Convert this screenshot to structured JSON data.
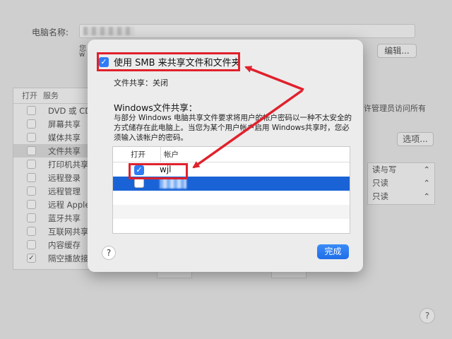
{
  "background": {
    "computer_name_label": "电脑名称:",
    "subtext_line1": "您",
    "subtext_line2": "w",
    "edit_button": "编辑...",
    "services_header": {
      "on": "打开",
      "service": "服务"
    },
    "services": [
      {
        "label": "DVD 或 CD",
        "checked": false,
        "selected": false
      },
      {
        "label": "屏幕共享",
        "checked": false,
        "selected": false
      },
      {
        "label": "媒体共享",
        "checked": false,
        "selected": false
      },
      {
        "label": "文件共享",
        "checked": false,
        "selected": true
      },
      {
        "label": "打印机共享",
        "checked": false,
        "selected": false
      },
      {
        "label": "远程登录",
        "checked": false,
        "selected": false
      },
      {
        "label": "远程管理",
        "checked": false,
        "selected": false
      },
      {
        "label": "远程 Apple",
        "checked": false,
        "selected": false
      },
      {
        "label": "蓝牙共享",
        "checked": false,
        "selected": false
      },
      {
        "label": "互联网共享",
        "checked": false,
        "selected": false
      },
      {
        "label": "内容缓存",
        "checked": false,
        "selected": false
      },
      {
        "label": "隔空播放接",
        "checked": true,
        "selected": false
      }
    ],
    "right_text": "许管理员访问所有",
    "options_button": "选项...",
    "permissions": [
      "读与写",
      "只读",
      "只读"
    ],
    "help": "?"
  },
  "sheet": {
    "smb_checkbox_label": "使用 SMB 来共享文件和文件夹",
    "smb_checked": true,
    "file_sharing_status": "文件共享：关闭",
    "windows_title": "Windows文件共享：",
    "windows_description": "与部分 Windows 电脑共享文件要求将用户的帐户密码以一种不太安全的方式储存在此电脑上。当您为某个用户帐户启用 Windows共享时，您必须输入该帐户的密码。",
    "table_header": {
      "on": "打开",
      "account": "帐户"
    },
    "accounts": [
      {
        "name": "wjl",
        "checked": true
      },
      {
        "name": "",
        "checked": false
      }
    ],
    "help": "?",
    "done_button": "完成"
  },
  "annotation_color": "#e0212c"
}
